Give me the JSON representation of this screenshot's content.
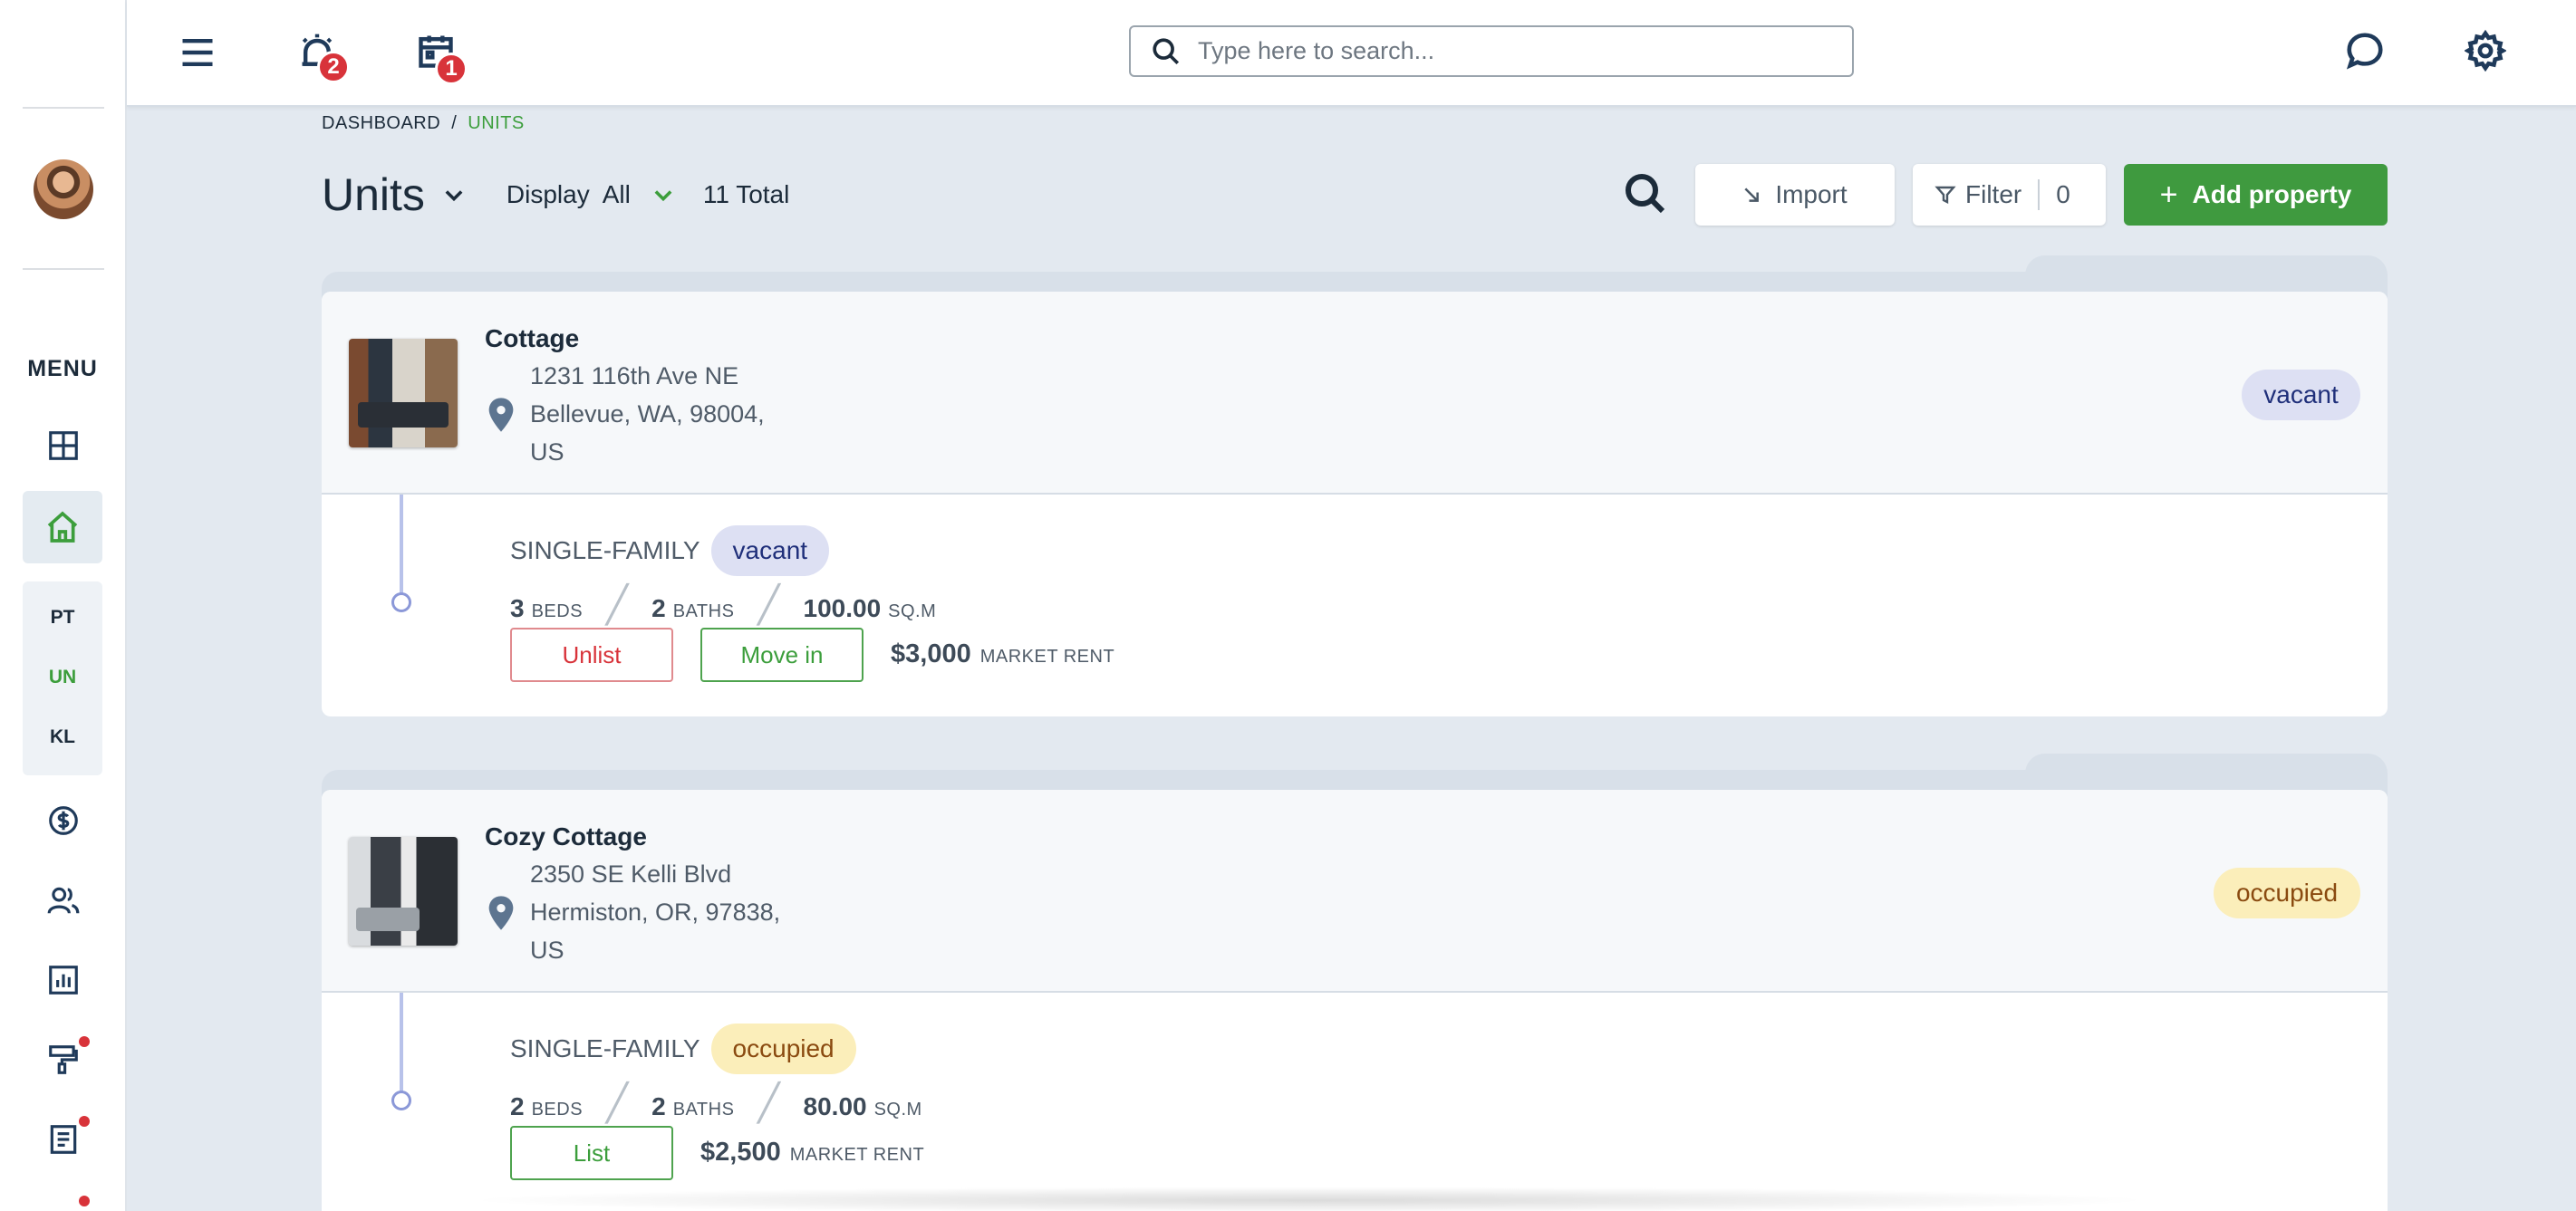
{
  "sidebar": {
    "menu_label": "MENU",
    "sub_items": [
      "PT",
      "UN",
      "KL"
    ]
  },
  "topbar": {
    "alarm_count": "2",
    "calendar_count": "1",
    "search_placeholder": "Type here to search..."
  },
  "breadcrumb": {
    "root": "DASHBOARD",
    "separator": "/",
    "current": "UNITS"
  },
  "header": {
    "title": "Units",
    "display_label": "Display",
    "display_value": "All",
    "total": "11 Total",
    "import_label": "Import",
    "filter_label": "Filter",
    "filter_count": "0",
    "add_label": "Add property",
    "add_plus": "+"
  },
  "colors": {
    "accent_green": "#3f9a3f",
    "vacant_bg": "#dde0f3",
    "occupied_bg": "#fbeeba",
    "alert_red": "#d8333a"
  },
  "properties": [
    {
      "name": "Cottage",
      "address_line1": "1231 116th Ave NE",
      "address_line2": "Bellevue, WA, 98004,",
      "address_line3": "US",
      "status": "vacant",
      "unit": {
        "type": "SINGLE-FAMILY",
        "status": "vacant",
        "beds": "3",
        "beds_label": "BEDS",
        "baths": "2",
        "baths_label": "BATHS",
        "area": "100.00",
        "area_label": "SQ.M",
        "actions": [
          "Unlist",
          "Move in"
        ],
        "rent": "$3,000",
        "rent_label": "MARKET RENT"
      }
    },
    {
      "name": "Cozy Cottage",
      "address_line1": "2350 SE Kelli Blvd",
      "address_line2": "Hermiston, OR, 97838,",
      "address_line3": "US",
      "status": "occupied",
      "unit": {
        "type": "SINGLE-FAMILY",
        "status": "occupied",
        "beds": "2",
        "beds_label": "BEDS",
        "baths": "2",
        "baths_label": "BATHS",
        "area": "80.00",
        "area_label": "SQ.M",
        "actions": [
          "List"
        ],
        "rent": "$2,500",
        "rent_label": "MARKET RENT"
      }
    }
  ]
}
